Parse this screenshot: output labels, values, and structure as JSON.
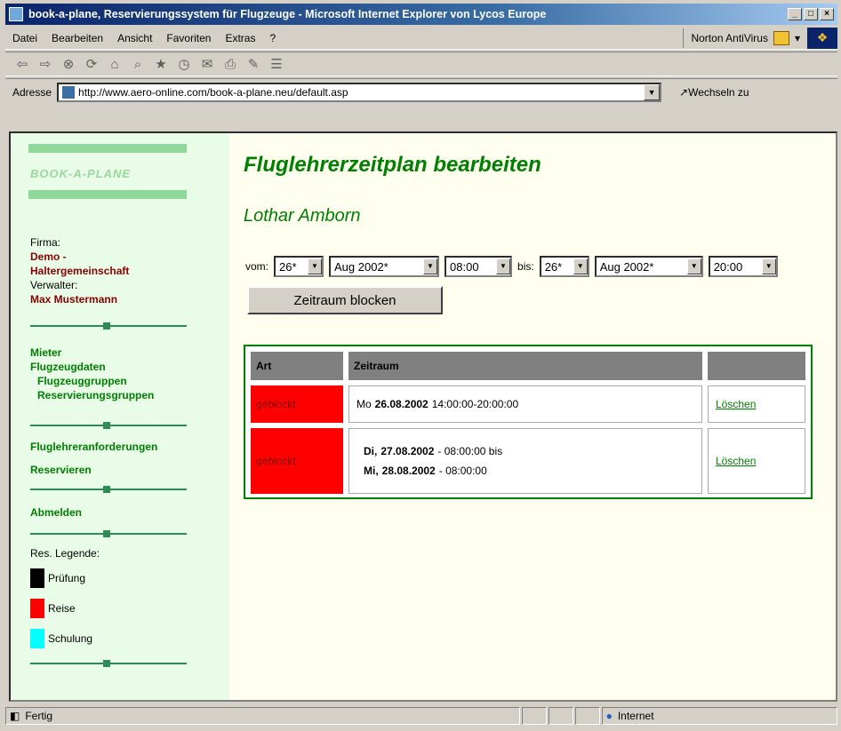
{
  "window": {
    "title": "book-a-plane, Reservierungssystem für Flugzeuge - Microsoft Internet Explorer von Lycos Europe"
  },
  "menu": {
    "items": [
      "Datei",
      "Bearbeiten",
      "Ansicht",
      "Favoriten",
      "Extras",
      "?"
    ],
    "norton": "Norton AntiVirus"
  },
  "address": {
    "label": "Adresse",
    "url": "http://www.aero-online.com/book-a-plane.neu/default.asp",
    "go": "Wechseln zu"
  },
  "sidebar": {
    "logo": "BOOK-A-PLANE",
    "firma_label": "Firma:",
    "firma_value_1": "Demo -",
    "firma_value_2": "Haltergemeinschaft",
    "verwalter_label": "Verwalter:",
    "verwalter_value": "Max Mustermann",
    "links": {
      "mieter": "Mieter",
      "flugzeugdaten": "Flugzeugdaten",
      "flugzeuggruppen": "Flugzeuggruppen",
      "reservierungsgruppen": "Reservierungsgruppen",
      "fluglehreranforderungen": "Fluglehreranforderungen",
      "reservieren": "Reservieren",
      "abmelden": "Abmelden"
    },
    "legend_title": "Res. Legende:",
    "legend": [
      {
        "label": "Prüfung",
        "color": "#000000"
      },
      {
        "label": "Reise",
        "color": "#ff0000"
      },
      {
        "label": "Schulung",
        "color": "#00ffff"
      }
    ]
  },
  "main": {
    "heading": "Fluglehrerzeitplan bearbeiten",
    "person": "Lothar Amborn",
    "vom_label": "vom:",
    "bis_label": "bis:",
    "vom_day": "26*",
    "vom_month": "Aug 2002*",
    "vom_time": "08:00",
    "bis_day": "26*",
    "bis_month": "Aug 2002*",
    "bis_time": "20:00",
    "block_button": "Zeitraum blocken",
    "table": {
      "headers": [
        "Art",
        "Zeitraum",
        ""
      ],
      "rows": [
        {
          "art": "geblockt",
          "day1": "Mo",
          "date1": "26.08.2002",
          "rest1": "14:00:00-20:00:00",
          "action": "Löschen"
        },
        {
          "art": "geblockt",
          "day1": "Di,",
          "date1": "27.08.2002",
          "rest1": "- 08:00:00 bis",
          "day2": "Mi,",
          "date2": "28.08.2002",
          "rest2": "- 08:00:00",
          "action": "Löschen"
        }
      ]
    }
  },
  "status": {
    "left": "Fertig",
    "zone": "Internet"
  }
}
